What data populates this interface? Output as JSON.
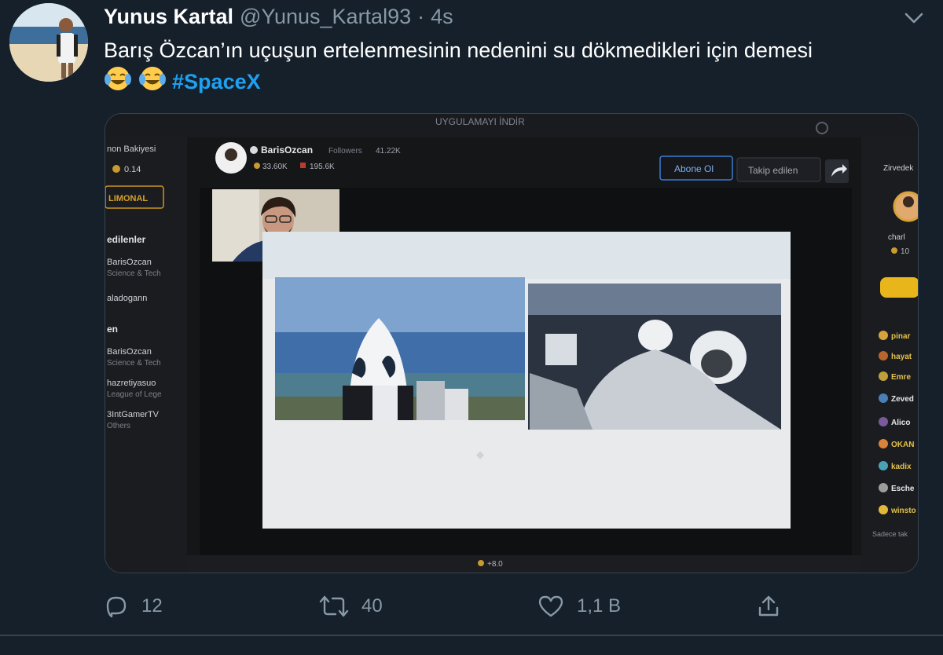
{
  "tweet": {
    "author_name": "Yunus Kartal",
    "handle": "@Yunus_Kartal93",
    "separator": "·",
    "timestamp": "4s",
    "text": "Barış Özcan’ın uçuşun ertelenmesinin nedenini su dökmedikleri için demesi",
    "emoji_count": 2,
    "hashtag": "#SpaceX"
  },
  "stream_screenshot": {
    "nav_items": [
      "UYGULAMAYI İNDİR"
    ],
    "sidebar": {
      "balance_label": "non Bakiyesi",
      "balance_value": "0.14",
      "button_label": "LIMONAL",
      "followed_heading": "edilenler",
      "followed_channels": [
        {
          "name": "BarisOzcan",
          "category": "Science & Tech"
        },
        {
          "name": "aladogann",
          "category": ""
        }
      ],
      "second_heading": "en",
      "recommended_channels": [
        {
          "name": "BarisOzcan",
          "category": "Science & Tech"
        },
        {
          "name": "hazretiyasuo",
          "category": "League of Lege"
        },
        {
          "name": "3IntGamerTV",
          "category": "Others"
        }
      ]
    },
    "channel": {
      "name": "BarisOzcan",
      "followers_label": "Followers",
      "followers_count": "41.22K",
      "stat_one": "33.60K",
      "stat_two": "195.6K",
      "subscribe_button": "Abone Ol",
      "follow_button": "Takip edilen"
    },
    "right_panel": {
      "heading": "Zirvedek",
      "top_user": "charl",
      "top_user_value": "10",
      "chat_users": [
        "pinar",
        "hayat",
        "Emre",
        "Zeved",
        "Alico",
        "OKAN",
        "kadix",
        "Esche",
        "winsto"
      ],
      "chat_footer": "Sadece tak"
    },
    "bottom_counter": "+8.0"
  },
  "actions": {
    "reply_count": "12",
    "retweet_count": "40",
    "like_count": "1,1 B"
  },
  "colors": {
    "background": "#15202b",
    "primary_text": "#ffffff",
    "secondary_text": "#8899a6",
    "hashtag": "#1da1f2",
    "divider": "#38444d"
  }
}
